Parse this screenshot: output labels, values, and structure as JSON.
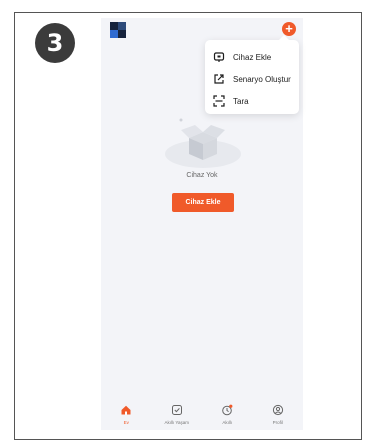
{
  "step_number": "3",
  "colors": {
    "accent": "#f05a2a",
    "background": "#f3f4f8",
    "menu_bg": "#ffffff",
    "badge": "#3b3b3b"
  },
  "header": {
    "add_icon": "plus-circle-icon",
    "logo_icon": "home-logo-icon"
  },
  "menu": {
    "items": [
      {
        "label": "Cihaz Ekle",
        "icon": "add-device-icon"
      },
      {
        "label": "Senaryo Oluştur",
        "icon": "create-scene-icon"
      },
      {
        "label": "Tara",
        "icon": "scan-icon"
      }
    ]
  },
  "empty_state": {
    "text": "Cihaz Yok",
    "button_label": "Cihaz Ekle"
  },
  "tabbar": {
    "tabs": [
      {
        "label": "Ev",
        "icon": "home-icon",
        "active": true
      },
      {
        "label": "Akıllı Yaşam",
        "icon": "smart-life-icon",
        "active": false
      },
      {
        "label": "Akıllı",
        "icon": "smart-icon",
        "active": false
      },
      {
        "label": "Profil",
        "icon": "profile-icon",
        "active": false
      }
    ]
  }
}
